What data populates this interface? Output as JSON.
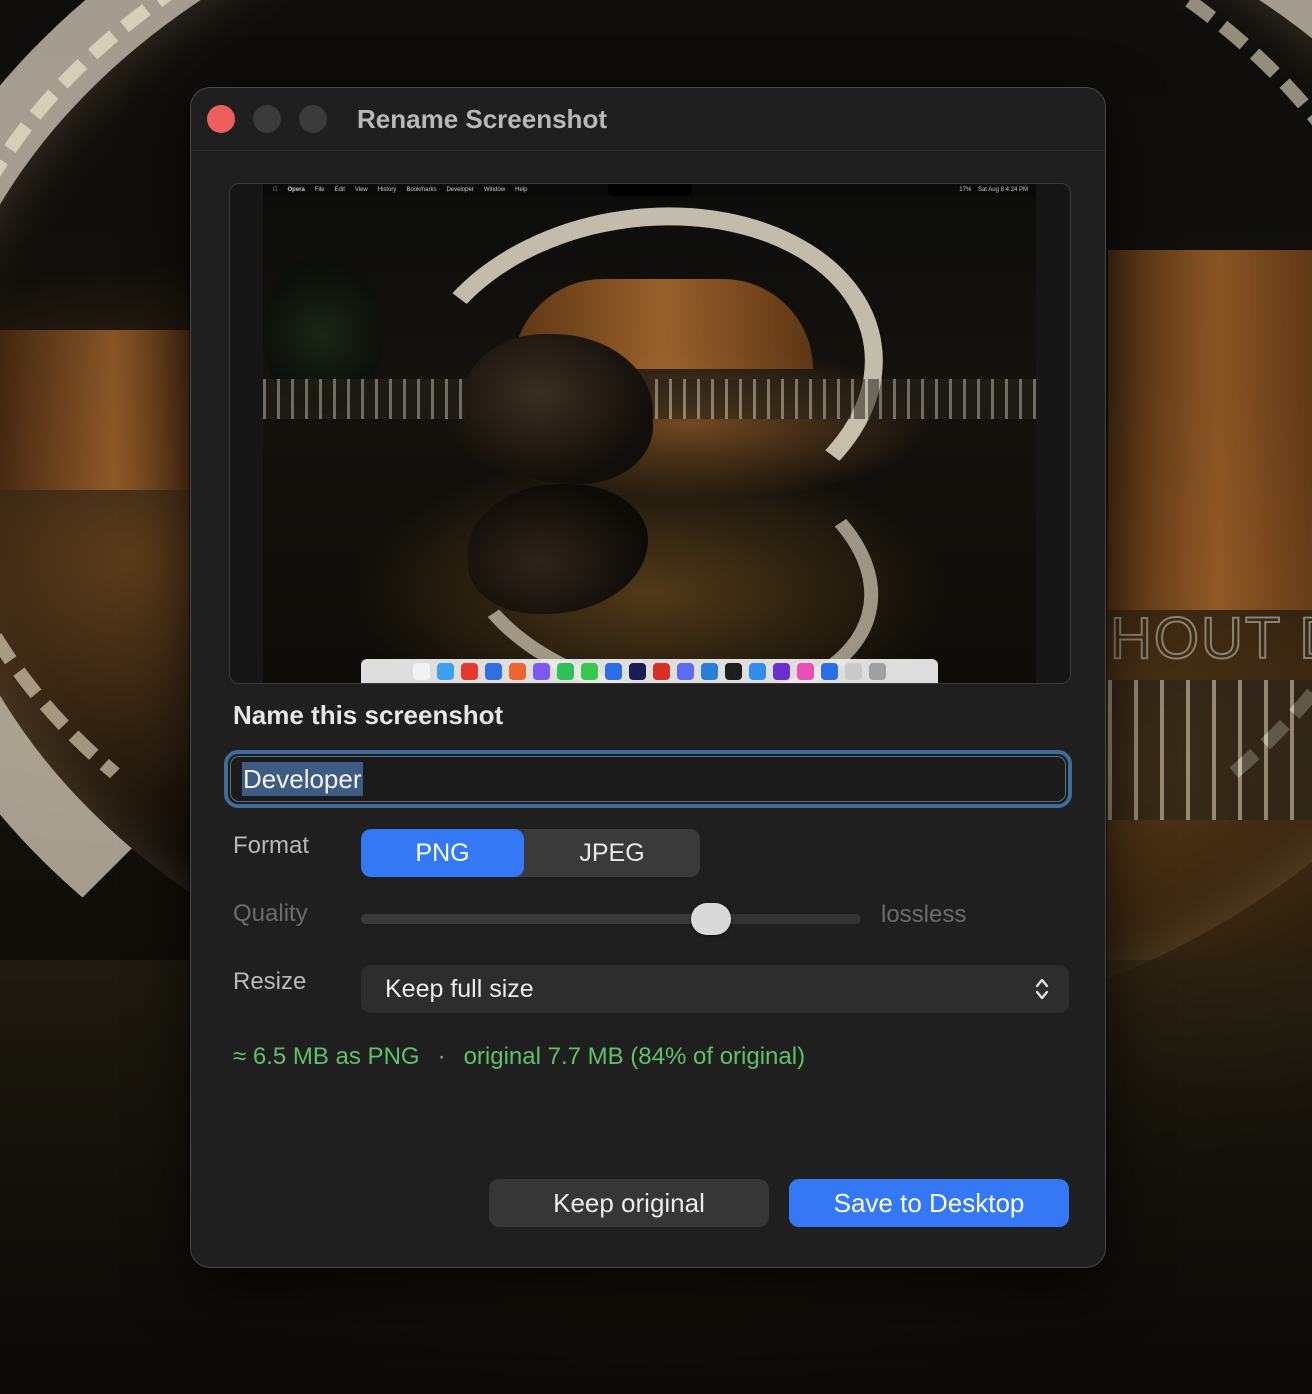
{
  "window": {
    "title": "Rename Screenshot"
  },
  "preview": {
    "menubar": {
      "items": [
        "Opera",
        "File",
        "Edit",
        "View",
        "History",
        "Bookmarks",
        "Developer",
        "Window",
        "Help"
      ],
      "battery": "17%",
      "clock": "Sat Aug 8 4:24 PM"
    },
    "dock_icon_colors": [
      "#f2f2f2",
      "#3ba1f0",
      "#e33b2e",
      "#2f6fe0",
      "#f0652f",
      "#7a5af0",
      "#2fc25b",
      "#36c94e",
      "#2a6fe6",
      "#1a1d52",
      "#d93025",
      "#5b6cf0",
      "#2a7fd6",
      "#1e1e1e",
      "#2f8ef0",
      "#6a2fd0",
      "#e94fb5",
      "#2a6fe6",
      "#c9c9c9",
      "#a0a0a0"
    ]
  },
  "form": {
    "name_heading": "Name this screenshot",
    "name_value": "Developer",
    "format_label": "Format",
    "format_options": [
      "PNG",
      "JPEG"
    ],
    "format_selected": "PNG",
    "quality_label": "Quality",
    "quality_level": 0.7,
    "quality_value_text": "lossless",
    "resize_label": "Resize",
    "resize_selected": "Keep full size"
  },
  "size_info": {
    "estimate": "≈ 6.5 MB as PNG",
    "separator": "·",
    "original": "original 7.7 MB (84% of original)"
  },
  "buttons": {
    "keep_original": "Keep original",
    "save": "Save to Desktop"
  },
  "colors": {
    "accent": "#3478f6",
    "close_button": "#ec5f5e",
    "success_text": "#5fc168",
    "focus_ring": "#3d6c9c"
  }
}
